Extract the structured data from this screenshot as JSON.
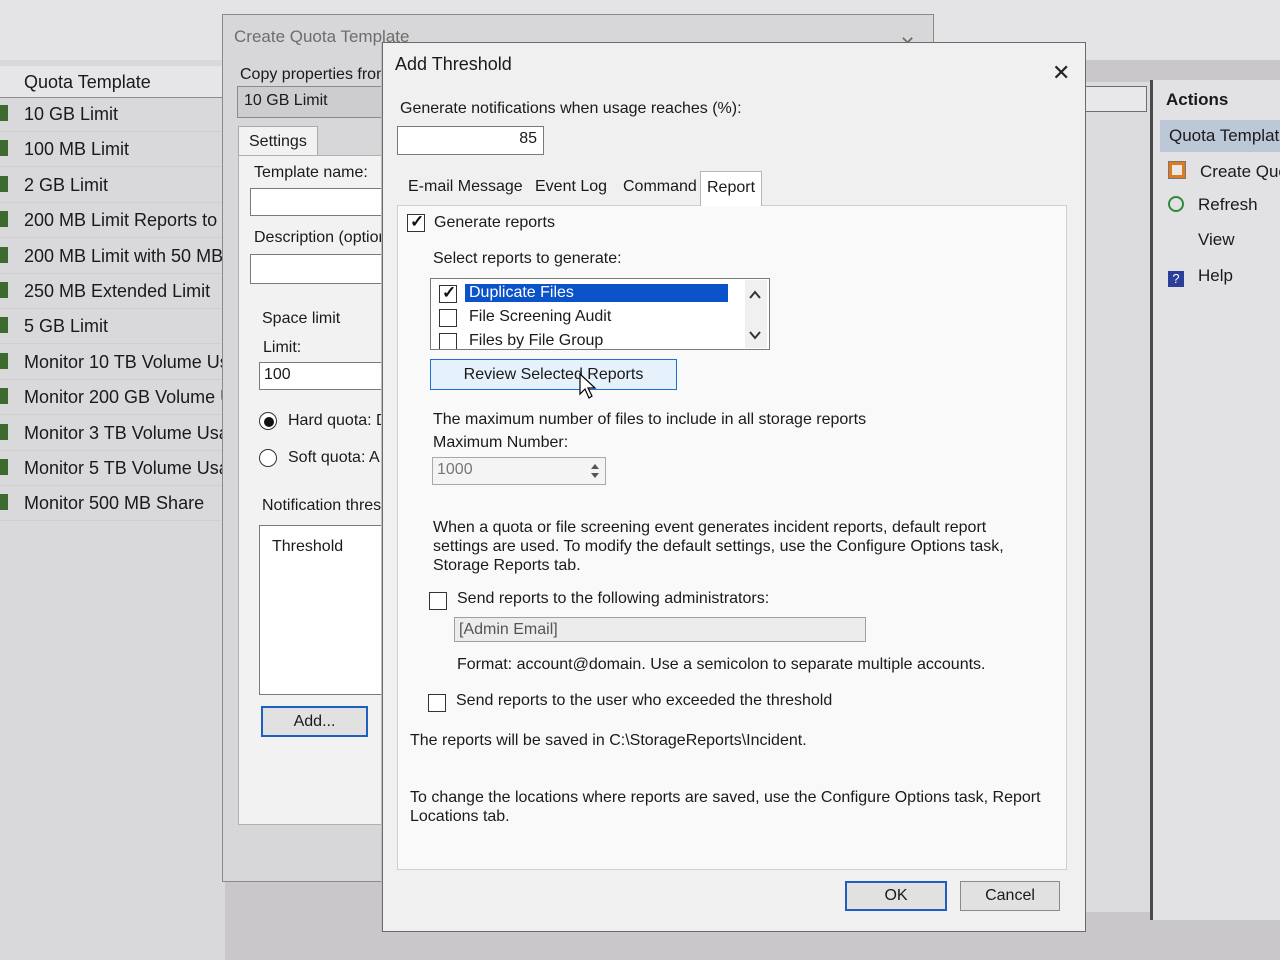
{
  "background": {
    "quota_template_header": "Quota Template",
    "quota_templates": [
      "10 GB Limit",
      "100 MB Limit",
      "2 GB Limit",
      "200 MB Limit Reports to U",
      "200 MB Limit with 50 MB",
      "250 MB Extended Limit",
      "5 GB Limit",
      "Monitor 10 TB Volume Us",
      "Monitor 200 GB Volume U",
      "Monitor 3 TB Volume Usa",
      "Monitor 5 TB Volume Usa",
      "Monitor 500 MB Share"
    ]
  },
  "actions_pane": {
    "title": "Actions",
    "selected": "Quota Templat",
    "items": [
      {
        "label": "Create Quo",
        "icon": "create-quota-icon"
      },
      {
        "label": "Refresh",
        "icon": "refresh-icon"
      },
      {
        "label": "View",
        "icon": ""
      },
      {
        "label": "Help",
        "icon": "help-icon"
      }
    ]
  },
  "create_quota_template": {
    "title": "Create Quota Template",
    "copy_from_label": "Copy properties from",
    "copy_from_value": "10 GB Limit",
    "settings_tab": "Settings",
    "template_name_label": "Template name:",
    "description_label": "Description (option",
    "space_limit_label": "Space limit",
    "limit_label": "Limit:",
    "limit_value": "100",
    "hard_quota_label": "Hard quota: D",
    "soft_quota_label": "Soft quota: A",
    "notification_label": "Notification thres",
    "threshold_header": "Threshold",
    "add_button": "Add..."
  },
  "add_threshold": {
    "title": "Add Threshold",
    "usage_label": "Generate notifications when usage reaches (%):",
    "usage_value": "85",
    "tabs": [
      "E-mail Message",
      "Event Log",
      "Command",
      "Report"
    ],
    "active_tab": "Report",
    "generate_reports_label": "Generate reports",
    "select_reports_label": "Select reports to generate:",
    "reports": [
      {
        "label": "Duplicate Files",
        "checked": true,
        "selected": true
      },
      {
        "label": "File Screening Audit",
        "checked": false,
        "selected": false
      },
      {
        "label": "Files by File Group",
        "checked": false,
        "selected": false
      }
    ],
    "review_button": "Review Selected Reports",
    "max_files_label": "The maximum number of files to include in all storage reports",
    "max_number_label": "Maximum Number:",
    "max_number_value": "1000",
    "incident_text": [
      "When a quota or file screening event generates incident reports, default report",
      "settings are used. To modify the default settings, use the Configure Options task,",
      "Storage Reports tab."
    ],
    "send_admins_label": "Send reports to the following administrators:",
    "admin_email_placeholder": "[Admin Email]",
    "format_text": "Format: account@domain. Use a semicolon to separate multiple accounts.",
    "send_user_label": "Send reports to the user who exceeded the threshold",
    "saved_location_text": "The reports will be saved in C:\\StorageReports\\Incident.",
    "change_location_text": [
      "To change the locations where reports are saved, use the Configure Options task, Report",
      "Locations tab."
    ],
    "ok_button": "OK",
    "cancel_button": "Cancel"
  }
}
